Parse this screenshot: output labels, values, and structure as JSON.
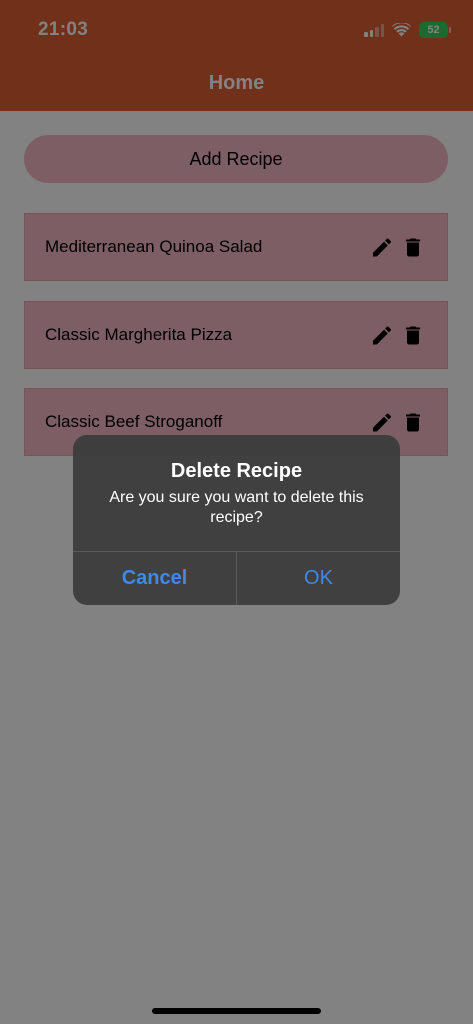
{
  "status_bar": {
    "time": "21:03",
    "battery": "52",
    "icons": [
      "signal-icon",
      "wifi-icon",
      "battery-icon"
    ]
  },
  "header": {
    "title": "Home",
    "color": "#de5f33"
  },
  "add_button": {
    "label": "Add Recipe",
    "color": "#f3b9c4"
  },
  "recipes": [
    {
      "name": "Mediterranean Quinoa Salad"
    },
    {
      "name": "Classic Margherita Pizza"
    },
    {
      "name": "Classic Beef Stroganoff"
    }
  ],
  "row_icons": [
    "edit-icon",
    "trash-icon"
  ],
  "dialog": {
    "title": "Delete Recipe",
    "message": "Are you sure you want to delete this recipe?",
    "cancel_label": "Cancel",
    "ok_label": "OK",
    "button_color": "#3d8aea"
  }
}
